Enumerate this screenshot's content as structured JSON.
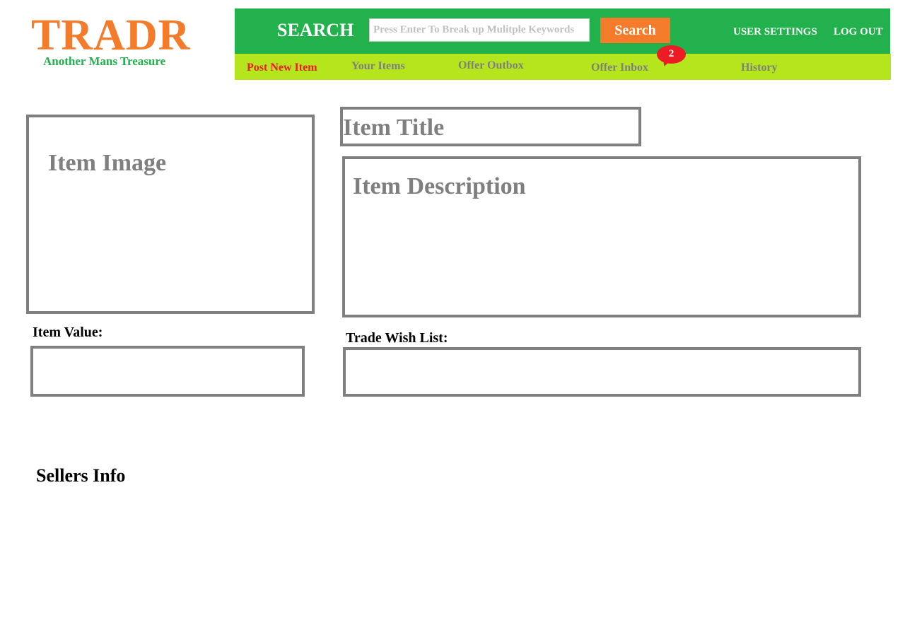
{
  "logo": {
    "title": "TRADR",
    "tagline": "Another Mans Treasure"
  },
  "search": {
    "heading": "SEARCH",
    "placeholder": "Press Enter To Break up Mulitple Keywords",
    "value": "",
    "button_label": "Search"
  },
  "header_links": {
    "user_settings": "USER SETTINGS",
    "log_out": "LOG OUT"
  },
  "nav": {
    "post_new_item": "Post New Item",
    "your_items": "Your Items",
    "offer_outbox": "Offer Outbox",
    "offer_inbox": "Offer Inbox",
    "offer_inbox_badge": "2",
    "history": "History"
  },
  "item": {
    "image_label": "Item Image",
    "title_label": "Item Title",
    "description_label": "Item Description",
    "value_label": "Item Value:",
    "wish_list_label": "Trade Wish List:"
  },
  "sellers_info": "Sellers Info",
  "colors": {
    "brand_orange": "#f47b2a",
    "brand_green": "#22b14c",
    "nav_lime": "#b5e61d",
    "active_red": "#ed1c24",
    "muted_gray": "#7f7f7f"
  }
}
